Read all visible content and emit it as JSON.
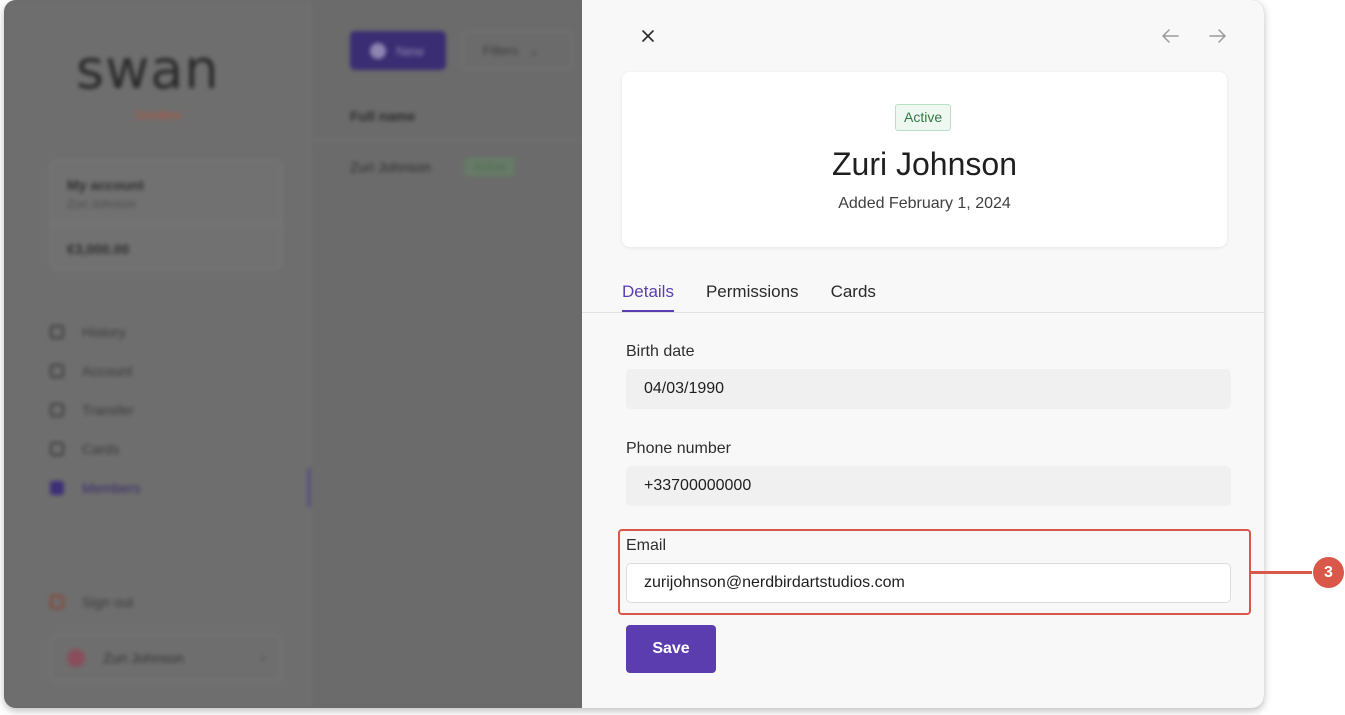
{
  "background": {
    "logo": "swan",
    "environment": "Sandbox",
    "account": {
      "title": "My account",
      "subtitle": "Zuri Johnson",
      "balance": "€3,000.00"
    },
    "nav": [
      {
        "label": "History",
        "icon": "history-icon"
      },
      {
        "label": "Account",
        "icon": "account-icon"
      },
      {
        "label": "Transfer",
        "icon": "transfer-icon"
      },
      {
        "label": "Cards",
        "icon": "card-icon"
      },
      {
        "label": "Members",
        "icon": "members-icon",
        "active": true
      }
    ],
    "sign_out": "Sign out",
    "user_name": "Zuri Johnson",
    "new_button": "New",
    "filters_button": "Filters",
    "column_header": "Full name",
    "row": {
      "name": "Zuri Johnson",
      "status": "Active"
    }
  },
  "drawer": {
    "status_badge": "Active",
    "member_name": "Zuri Johnson",
    "added_text": "Added February 1, 2024",
    "tabs": [
      "Details",
      "Permissions",
      "Cards"
    ],
    "active_tab": "Details",
    "fields": {
      "birth_date": {
        "label": "Birth date",
        "value": "04/03/1990"
      },
      "phone": {
        "label": "Phone number",
        "value": "+33700000000"
      },
      "email": {
        "label": "Email",
        "value": "zurijohnson@nerdbirdartstudios.com"
      }
    },
    "save_label": "Save"
  },
  "callout": {
    "number": "3",
    "color": "#d9584a"
  },
  "colors": {
    "accent": "#5b3db0",
    "success": "#2e7a45"
  }
}
